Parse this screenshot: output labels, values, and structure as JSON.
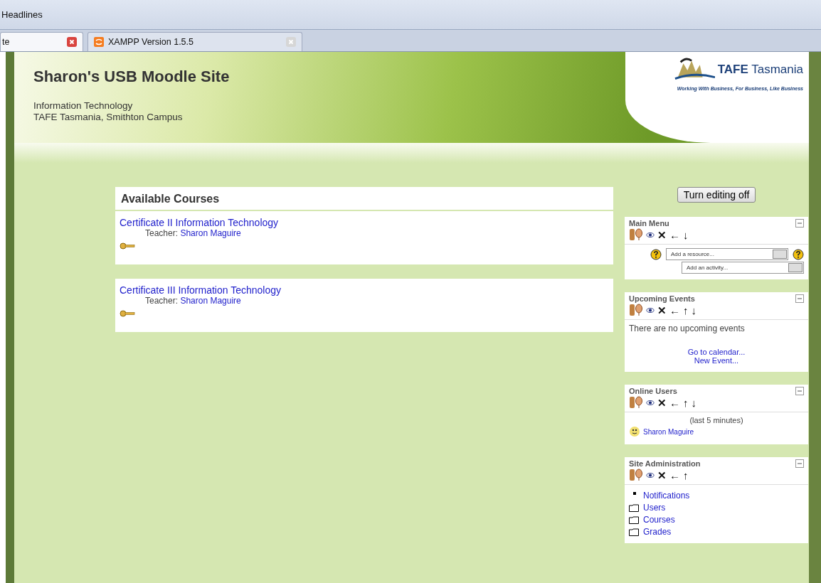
{
  "bookmarks_bar": {
    "item": "Headlines"
  },
  "tabs": [
    {
      "label": "te",
      "selected": true
    },
    {
      "label": "XAMPP Version 1.5.5",
      "selected": false
    }
  ],
  "header": {
    "title": "Sharon's USB Moodle Site",
    "subtitle": [
      "Information Technology",
      "TAFE Tasmania, Smithton Campus"
    ],
    "logo": {
      "name": "TAFE",
      "name2": "Tasmania",
      "tagline": "Working With Business, For Business, Like Business"
    }
  },
  "courses": {
    "heading": "Available Courses",
    "items": [
      {
        "title": "Certificate II Information Technology",
        "teacher_label": "Teacher:",
        "teacher": "Sharon Maguire"
      },
      {
        "title": "Certificate III Information Technology",
        "teacher_label": "Teacher:",
        "teacher": "Sharon Maguire"
      }
    ]
  },
  "edit_button": "Turn editing off",
  "blocks": [
    {
      "kind": "menu",
      "title": "Main Menu",
      "actions": [
        "✕",
        "←",
        "↓"
      ],
      "resource_select": "Add a resource...",
      "activity_select": "Add an activity..."
    },
    {
      "kind": "events",
      "title": "Upcoming Events",
      "actions": [
        "✕",
        "←",
        "↑",
        "↓"
      ],
      "text": "There are no upcoming events",
      "links": [
        "Go to calendar...",
        "New Event..."
      ]
    },
    {
      "kind": "users",
      "title": "Online Users",
      "actions": [
        "✕",
        "←",
        "↑",
        "↓"
      ],
      "note": "(last 5 minutes)",
      "users": [
        "Sharon Maguire"
      ]
    },
    {
      "kind": "admin",
      "title": "Site Administration",
      "actions": [
        "✕",
        "←",
        "↑"
      ],
      "items": [
        {
          "kind": "bullet",
          "label": "Notifications"
        },
        {
          "kind": "folder",
          "label": "Users"
        },
        {
          "kind": "folder",
          "label": "Courses"
        },
        {
          "kind": "folder",
          "label": "Grades"
        }
      ]
    }
  ]
}
